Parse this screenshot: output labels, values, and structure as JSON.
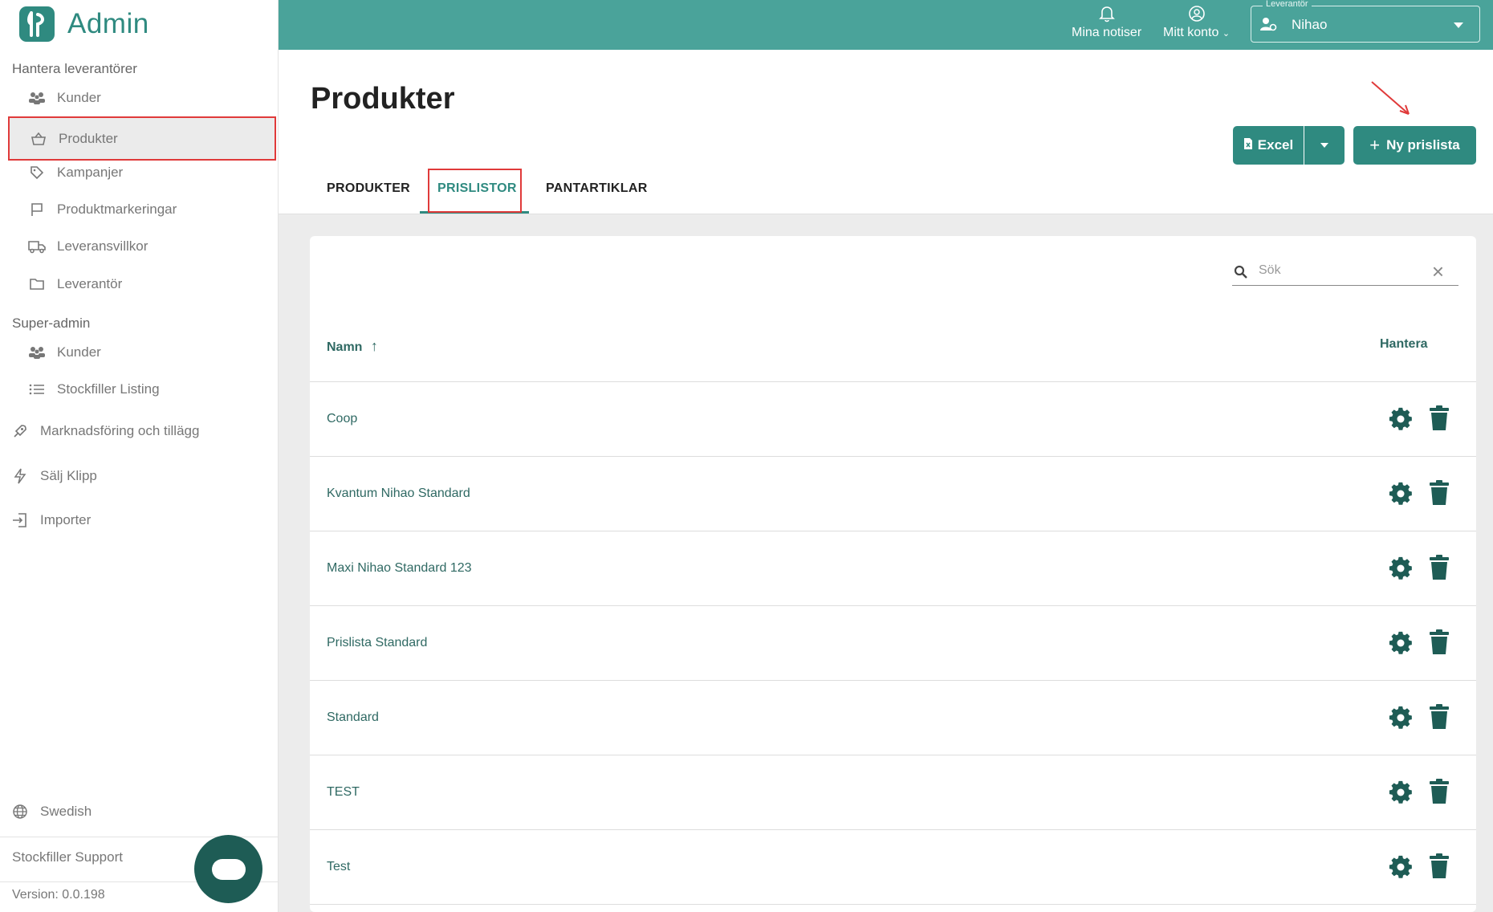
{
  "app": {
    "title": "Admin"
  },
  "sidebar": {
    "section_suppliers": "Hantera leverantörer",
    "suppliers_items": [
      {
        "label": "Kunder",
        "icon": "users-icon"
      },
      {
        "label": "Produkter",
        "icon": "basket-icon"
      },
      {
        "label": "Kampanjer",
        "icon": "tag-icon"
      },
      {
        "label": "Produktmarkeringar",
        "icon": "flag-icon"
      },
      {
        "label": "Leveransvillkor",
        "icon": "truck-icon"
      },
      {
        "label": "Leverantör",
        "icon": "folder-icon"
      }
    ],
    "section_superadmin": "Super-admin",
    "superadmin_items": [
      {
        "label": "Kunder",
        "icon": "users-icon"
      },
      {
        "label": "Stockfiller Listing",
        "icon": "list-icon"
      }
    ],
    "top_items": [
      {
        "label": "Marknadsföring och tillägg",
        "icon": "rocket-icon"
      },
      {
        "label": "Sälj Klipp",
        "icon": "bolt-icon"
      },
      {
        "label": "Importer",
        "icon": "import-icon"
      }
    ],
    "language": "Swedish",
    "support": "Stockfiller Support",
    "version": "Version: 0.0.198"
  },
  "topbar": {
    "notifications": "Mina notiser",
    "account": "Mitt konto",
    "supplier_legend": "Leverantör",
    "supplier_value": "Nihao"
  },
  "page": {
    "title": "Produkter",
    "excel_label": "Excel",
    "new_pricelist_label": "Ny prislista",
    "tabs": [
      "PRODUKTER",
      "PRISLISTOR",
      "PANTARTIKLAR"
    ]
  },
  "table": {
    "search_placeholder": "Sök",
    "col_name": "Namn",
    "col_manage": "Hantera",
    "rows": [
      "Coop",
      "Kvantum Nihao Standard",
      "Maxi Nihao Standard 123",
      "Prislista Standard",
      "Standard",
      "TEST",
      "Test"
    ]
  },
  "colors": {
    "accent": "#2f8a80",
    "topbar": "#4aa39a",
    "highlight": "#e03a3a"
  }
}
